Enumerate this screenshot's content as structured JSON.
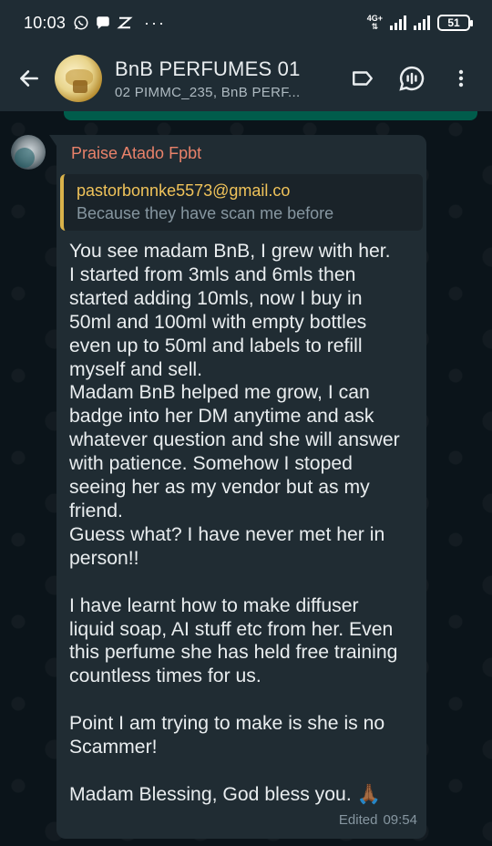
{
  "status_bar": {
    "time": "10:03",
    "network_label": "4G+",
    "battery": "51"
  },
  "header": {
    "title": "BnB PERFUMES 01",
    "subtitle": "02 PIMMC_235, BnB PERF..."
  },
  "message": {
    "author": "Praise Atado Fpbt",
    "quote_author": "pastorbonnke5573@gmail.co",
    "quote_text": "Because they have scan me before",
    "lines": [
      "You see madam BnB, I grew with her.",
      "I started from 3mls and 6mls then",
      "started adding 10mls, now I buy in",
      "50ml and 100ml with empty bottles",
      "even up to 50ml and labels to refill",
      "myself and sell.",
      "Madam BnB helped me grow, I can",
      "badge into her DM anytime and ask",
      "whatever question and she will answer",
      "with patience. Somehow I stoped",
      "seeing her as my vendor but as my",
      "friend.",
      "Guess what? I have never met her in",
      "person!!",
      "",
      "I have learnt how to make diffuser",
      "liquid soap, AI stuff etc from her. Even",
      "this perfume she has held free training",
      "countless times for us.",
      "",
      "Point I am trying to make is she is no",
      "Scammer!",
      "",
      "Madam Blessing, God bless you. 🙏🏾"
    ],
    "edited_label": "Edited",
    "time": "09:54"
  },
  "colors": {
    "header_bg": "#1f2c34",
    "chat_bg": "#0b141a",
    "bubble_bg": "#202c33",
    "author_color": "#e9826a",
    "quote_bar": "#d9b24a"
  }
}
